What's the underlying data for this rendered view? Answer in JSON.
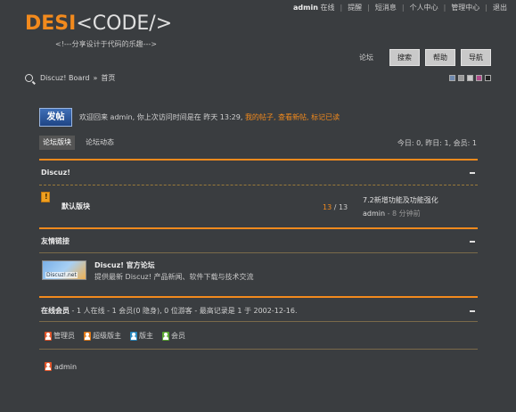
{
  "topbar": {
    "username": "admin",
    "status": "在线",
    "reminders": "提醒",
    "messages": "短消息",
    "profile": "个人中心",
    "admin_center": "管理中心",
    "logout": "退出"
  },
  "logo": {
    "part1": "DESI",
    "part2": "<CODE/>",
    "slogan": "<!---分享设计于代码的乐趣--->"
  },
  "nav": {
    "forum": "论坛",
    "search": "搜索",
    "help": "帮助",
    "guide": "导航"
  },
  "breadcrumb": {
    "site": "Discuz! Board",
    "sep": "»",
    "page": "首页"
  },
  "swatches": [
    "#6f8ab0",
    "#9a9a9a",
    "#c9c9c9",
    "#b04a8a",
    "#222222"
  ],
  "welcome": {
    "post_button": "发帖",
    "text": "欢迎回来 admin, 你上次访问时间是在 昨天 13:29,",
    "my_posts": "我的帖子",
    "sep1": ",",
    "new_posts": "查看新帖",
    "sep2": ",",
    "mark_read": "标记已读"
  },
  "tabs": {
    "forum_board": "论坛版块",
    "forum_activity": "论坛动态"
  },
  "stats": "今日: 0, 昨日: 1, 会员: 1",
  "category": {
    "title": "Discuz!",
    "forum": {
      "name": "默认版块",
      "threads": "13",
      "sep": " / ",
      "posts": "13",
      "last_title": "7.2新增功能及功能强化",
      "last_author": "admin",
      "last_time": " - 8 分钟前"
    }
  },
  "friendlinks": {
    "title": "友情链接",
    "image_label": "Discuz!.net",
    "name": "Discuz! 官方论坛",
    "desc": "提供最新 Discuz! 产品新闻、软件下载与技术交流"
  },
  "online": {
    "label": "在线会员",
    "detail": " - 1 人在线  - 1 会员(0 隐身), 0 位游客  - 最高记录是  1 于  2002-12-16.",
    "legend": [
      {
        "label": "管理员",
        "color": "#e0552a"
      },
      {
        "label": "超级版主",
        "color": "#e07a1a"
      },
      {
        "label": "版主",
        "color": "#2a8ac0"
      },
      {
        "label": "会员",
        "color": "#5aa830"
      }
    ],
    "users": [
      {
        "name": "admin",
        "color": "#e0552a"
      }
    ]
  }
}
